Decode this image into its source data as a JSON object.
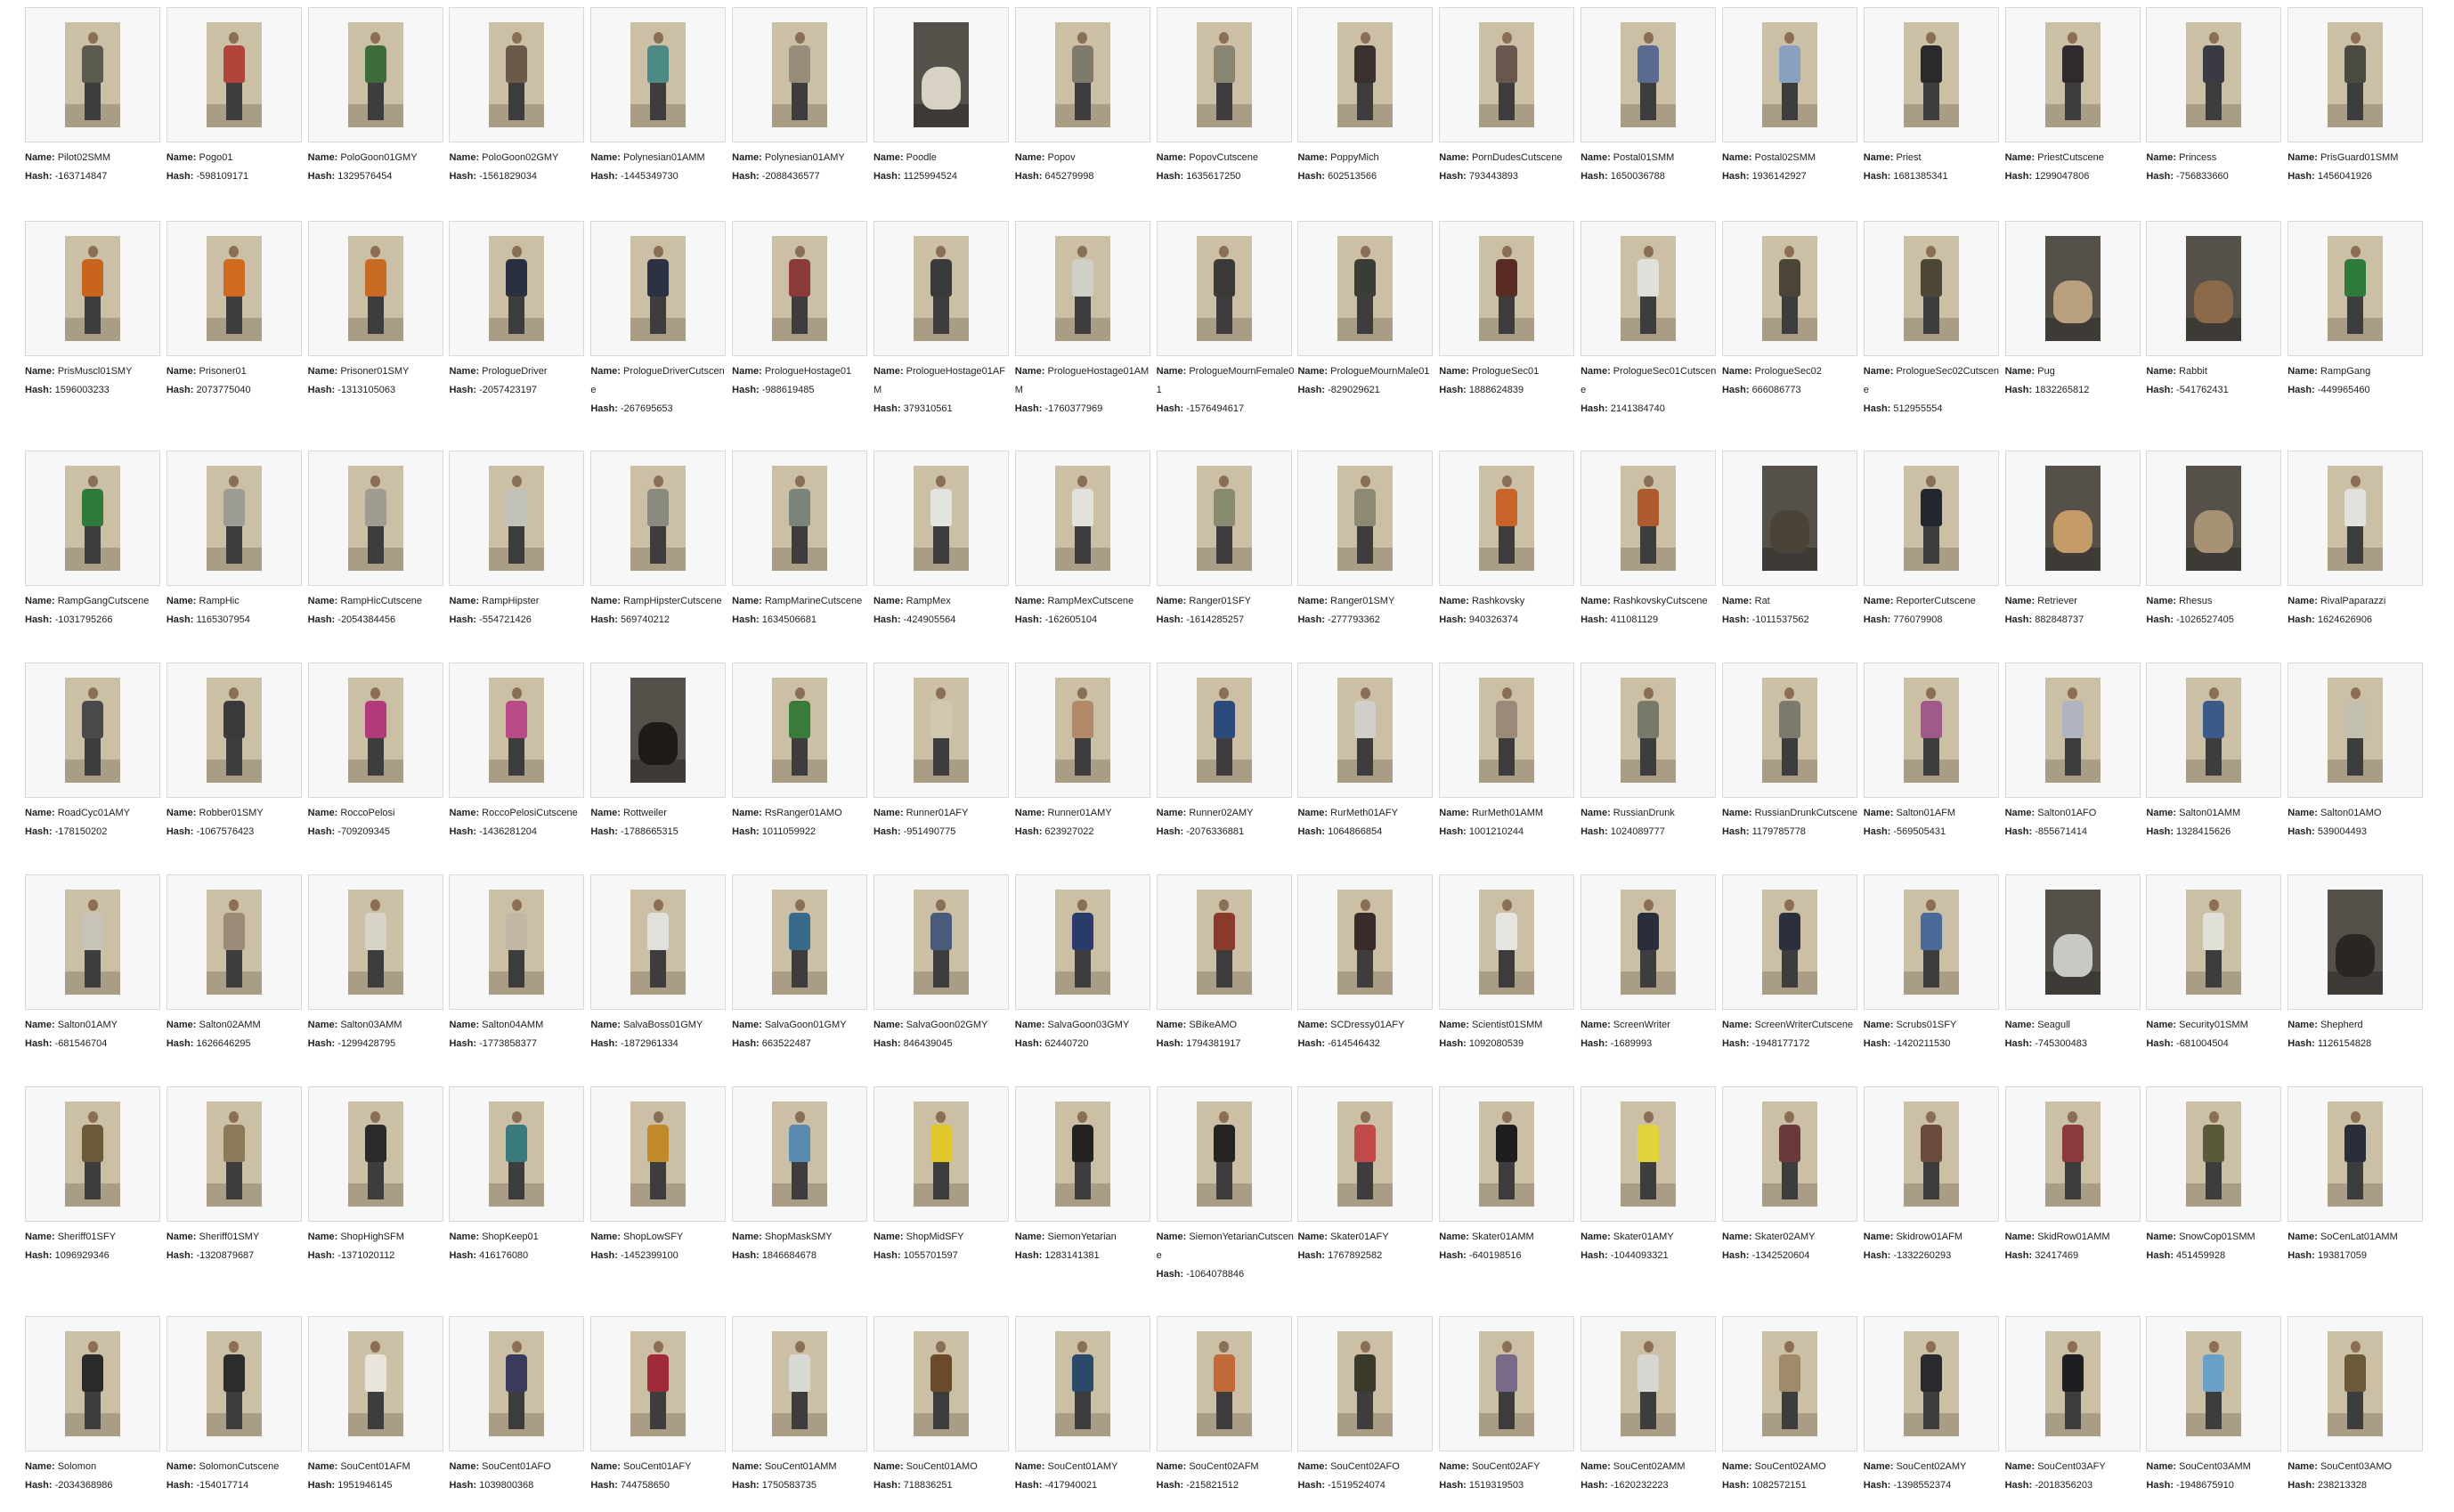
{
  "rows": [
    [
      {
        "name": "Pilot02SMM",
        "hash": "-163714847",
        "color": "#5a5a4e",
        "kind": "person"
      },
      {
        "name": "Pogo01",
        "hash": "-598109171",
        "color": "#b0443a",
        "kind": "person"
      },
      {
        "name": "PoloGoon01GMY",
        "hash": "1329576454",
        "color": "#3e6b3a",
        "kind": "person"
      },
      {
        "name": "PoloGoon02GMY",
        "hash": "-1561829034",
        "color": "#6a5a4a",
        "kind": "person"
      },
      {
        "name": "Polynesian01AMM",
        "hash": "-1445349730",
        "color": "#4f8b86",
        "kind": "person"
      },
      {
        "name": "Polynesian01AMY",
        "hash": "-2088436577",
        "color": "#9a8c7a",
        "kind": "person"
      },
      {
        "name": "Poodle",
        "hash": "1125994524",
        "color": "#d8d2c4",
        "kind": "animal"
      },
      {
        "name": "Popov",
        "hash": "645279998",
        "color": "#7f7a6a",
        "kind": "person"
      },
      {
        "name": "PopovCutscene",
        "hash": "1635617250",
        "color": "#8a8572",
        "kind": "person"
      },
      {
        "name": "PoppyMich",
        "hash": "602513566",
        "color": "#3a3030",
        "kind": "person"
      },
      {
        "name": "PornDudesCutscene",
        "hash": "793443893",
        "color": "#6a5850",
        "kind": "person"
      },
      {
        "name": "Postal01SMM",
        "hash": "1650036788",
        "color": "#5a6a90",
        "kind": "person"
      },
      {
        "name": "Postal02SMM",
        "hash": "1936142927",
        "color": "#8aa0c0",
        "kind": "person"
      },
      {
        "name": "Priest",
        "hash": "1681385341",
        "color": "#2a2a2a",
        "kind": "person"
      },
      {
        "name": "PriestCutscene",
        "hash": "1299047806",
        "color": "#2e2a2e",
        "kind": "person"
      },
      {
        "name": "Princess",
        "hash": "-756833660",
        "color": "#3a3a44",
        "kind": "person"
      },
      {
        "name": "PrisGuard01SMM",
        "hash": "1456041926",
        "color": "#4a4a40",
        "kind": "person"
      }
    ],
    [
      {
        "name": "PrisMuscl01SMY",
        "hash": "1596003233",
        "color": "#c8641e",
        "kind": "person"
      },
      {
        "name": "Prisoner01",
        "hash": "2073775040",
        "color": "#d06a20",
        "kind": "person"
      },
      {
        "name": "Prisoner01SMY",
        "hash": "-1313105063",
        "color": "#c96a24",
        "kind": "person"
      },
      {
        "name": "PrologueDriver",
        "hash": "-2057423197",
        "color": "#2a3040",
        "kind": "person"
      },
      {
        "name": "PrologueDriverCutscene",
        "hash": "-267695653",
        "color": "#2c3242",
        "kind": "person"
      },
      {
        "name": "PrologueHostage01",
        "hash": "-988619485",
        "color": "#8a3a3a",
        "kind": "person"
      },
      {
        "name": "PrologueHostage01AFM",
        "hash": "379310561",
        "color": "#3a3a3a",
        "kind": "person"
      },
      {
        "name": "PrologueHostage01AMM",
        "hash": "-1760377969",
        "color": "#cfcfc6",
        "kind": "person"
      },
      {
        "name": "PrologueMournFemale01",
        "hash": "-1576494617",
        "color": "#3a3a36",
        "kind": "person"
      },
      {
        "name": "PrologueMournMale01",
        "hash": "-829029621",
        "color": "#3a3c38",
        "kind": "person"
      },
      {
        "name": "PrologueSec01",
        "hash": "1888624839",
        "color": "#5a2a24",
        "kind": "person"
      },
      {
        "name": "PrologueSec01Cutscene",
        "hash": "2141384740",
        "color": "#e0e0da",
        "kind": "person"
      },
      {
        "name": "PrologueSec02",
        "hash": "666086773",
        "color": "#4a4536",
        "kind": "person"
      },
      {
        "name": "PrologueSec02Cutscene",
        "hash": "512955554",
        "color": "#4c4636",
        "kind": "person"
      },
      {
        "name": "Pug",
        "hash": "1832265812",
        "color": "#b8a07e",
        "kind": "animal"
      },
      {
        "name": "Rabbit",
        "hash": "-541762431",
        "color": "#8a6a48",
        "kind": "animal"
      },
      {
        "name": "RampGang",
        "hash": "-449965460",
        "color": "#2f7a3a",
        "kind": "person"
      }
    ],
    [
      {
        "name": "RampGangCutscene",
        "hash": "-1031795266",
        "color": "#2f7a3a",
        "kind": "person"
      },
      {
        "name": "RampHic",
        "hash": "1165307954",
        "color": "#9c9c94",
        "kind": "person"
      },
      {
        "name": "RampHicCutscene",
        "hash": "-2054384456",
        "color": "#a09c92",
        "kind": "person"
      },
      {
        "name": "RampHipster",
        "hash": "-554721426",
        "color": "#c2c2ba",
        "kind": "person"
      },
      {
        "name": "RampHipsterCutscene",
        "hash": "569740212",
        "color": "#8a8a7e",
        "kind": "person"
      },
      {
        "name": "RampMarineCutscene",
        "hash": "1634506681",
        "color": "#7a8478",
        "kind": "person"
      },
      {
        "name": "RampMex",
        "hash": "-424905564",
        "color": "#e4e4de",
        "kind": "person"
      },
      {
        "name": "RampMexCutscene",
        "hash": "-162605104",
        "color": "#e2e2dc",
        "kind": "person"
      },
      {
        "name": "Ranger01SFY",
        "hash": "-1614285257",
        "color": "#8a8a70",
        "kind": "person"
      },
      {
        "name": "Ranger01SMY",
        "hash": "-277793362",
        "color": "#8c8a72",
        "kind": "person"
      },
      {
        "name": "Rashkovsky",
        "hash": "940326374",
        "color": "#c8642a",
        "kind": "person"
      },
      {
        "name": "RashkovskyCutscene",
        "hash": "411081129",
        "color": "#b05a30",
        "kind": "person"
      },
      {
        "name": "Rat",
        "hash": "-1011537562",
        "color": "#4a4438",
        "kind": "animal"
      },
      {
        "name": "ReporterCutscene",
        "hash": "776079908",
        "color": "#22262e",
        "kind": "person"
      },
      {
        "name": "Retriever",
        "hash": "882848737",
        "color": "#c49a66",
        "kind": "animal"
      },
      {
        "name": "Rhesus",
        "hash": "-1026527405",
        "color": "#a89276",
        "kind": "animal"
      },
      {
        "name": "RivalPaparazzi",
        "hash": "1624626906",
        "color": "#e2e2dc",
        "kind": "person"
      }
    ],
    [
      {
        "name": "RoadCyc01AMY",
        "hash": "-178150202",
        "color": "#4a4a4a",
        "kind": "person"
      },
      {
        "name": "Robber01SMY",
        "hash": "-1067576423",
        "color": "#3a3a3a",
        "kind": "person"
      },
      {
        "name": "RoccoPelosi",
        "hash": "-709209345",
        "color": "#b03a7a",
        "kind": "person"
      },
      {
        "name": "RoccoPelosiCutscene",
        "hash": "-1436281204",
        "color": "#b84a86",
        "kind": "person"
      },
      {
        "name": "Rottweiler",
        "hash": "-1788665315",
        "color": "#1e1a18",
        "kind": "animal"
      },
      {
        "name": "RsRanger01AMO",
        "hash": "1011059922",
        "color": "#3a7a3a",
        "kind": "person"
      },
      {
        "name": "Runner01AFY",
        "hash": "-951490775",
        "color": "#d0c8b0",
        "kind": "person"
      },
      {
        "name": "Runner01AMY",
        "hash": "623927022",
        "color": "#b08a6a",
        "kind": "person"
      },
      {
        "name": "Runner02AMY",
        "hash": "-2076336881",
        "color": "#2a4a7a",
        "kind": "person"
      },
      {
        "name": "RurMeth01AFY",
        "hash": "1064866854",
        "color": "#d0cfc8",
        "kind": "person"
      },
      {
        "name": "RurMeth01AMM",
        "hash": "1001210244",
        "color": "#9a8a7a",
        "kind": "person"
      },
      {
        "name": "RussianDrunk",
        "hash": "1024089777",
        "color": "#7a7a6a",
        "kind": "person"
      },
      {
        "name": "RussianDrunkCutscene",
        "hash": "1179785778",
        "color": "#7c7a6c",
        "kind": "person"
      },
      {
        "name": "Salton01AFM",
        "hash": "-569505431",
        "color": "#a05a8a",
        "kind": "person"
      },
      {
        "name": "Salton01AFO",
        "hash": "-855671414",
        "color": "#b0b4c0",
        "kind": "person"
      },
      {
        "name": "Salton01AMM",
        "hash": "1328415626",
        "color": "#3a5a8a",
        "kind": "person"
      },
      {
        "name": "Salton01AMO",
        "hash": "539004493",
        "color": "#c4c0b0",
        "kind": "person"
      }
    ],
    [
      {
        "name": "Salton01AMY",
        "hash": "-681546704",
        "color": "#c8c4b8",
        "kind": "person"
      },
      {
        "name": "Salton02AMM",
        "hash": "1626646295",
        "color": "#9a8a76",
        "kind": "person"
      },
      {
        "name": "Salton03AMM",
        "hash": "-1299428795",
        "color": "#d8d4c8",
        "kind": "person"
      },
      {
        "name": "Salton04AMM",
        "hash": "-1773858377",
        "color": "#c0b8a4",
        "kind": "person"
      },
      {
        "name": "SalvaBoss01GMY",
        "hash": "-1872961334",
        "color": "#e0e0dc",
        "kind": "person"
      },
      {
        "name": "SalvaGoon01GMY",
        "hash": "663522487",
        "color": "#3a6a8a",
        "kind": "person"
      },
      {
        "name": "SalvaGoon02GMY",
        "hash": "846439045",
        "color": "#4a5a7a",
        "kind": "person"
      },
      {
        "name": "SalvaGoon03GMY",
        "hash": "62440720",
        "color": "#2a3a6a",
        "kind": "person"
      },
      {
        "name": "SBikeAMO",
        "hash": "1794381917",
        "color": "#8a3a2a",
        "kind": "person"
      },
      {
        "name": "SCDressy01AFY",
        "hash": "-614546432",
        "color": "#3a2a2a",
        "kind": "person"
      },
      {
        "name": "Scientist01SMM",
        "hash": "1092080539",
        "color": "#e4e4e0",
        "kind": "person"
      },
      {
        "name": "ScreenWriter",
        "hash": "-1689993",
        "color": "#2a2e3a",
        "kind": "person"
      },
      {
        "name": "ScreenWriterCutscene",
        "hash": "-1948177172",
        "color": "#2c303c",
        "kind": "person"
      },
      {
        "name": "Scrubs01SFY",
        "hash": "-1420211530",
        "color": "#4a6a9a",
        "kind": "person"
      },
      {
        "name": "Seagull",
        "hash": "-745300483",
        "color": "#c8c8c4",
        "kind": "animal"
      },
      {
        "name": "Security01SMM",
        "hash": "-681004504",
        "color": "#e0e0d8",
        "kind": "person"
      },
      {
        "name": "Shepherd",
        "hash": "1126154828",
        "color": "#2a2622",
        "kind": "animal"
      }
    ],
    [
      {
        "name": "Sheriff01SFY",
        "hash": "1096929346",
        "color": "#6a5a3a",
        "kind": "person"
      },
      {
        "name": "Sheriff01SMY",
        "hash": "-1320879687",
        "color": "#8a7a5a",
        "kind": "person"
      },
      {
        "name": "ShopHighSFM",
        "hash": "-1371020112",
        "color": "#2a2a2a",
        "kind": "person"
      },
      {
        "name": "ShopKeep01",
        "hash": "416176080",
        "color": "#3a7a7a",
        "kind": "person"
      },
      {
        "name": "ShopLowSFY",
        "hash": "-1452399100",
        "color": "#c08a2a",
        "kind": "person"
      },
      {
        "name": "ShopMaskSMY",
        "hash": "1846684678",
        "color": "#5a8ab0",
        "kind": "person"
      },
      {
        "name": "ShopMidSFY",
        "hash": "1055701597",
        "color": "#e0c82a",
        "kind": "person"
      },
      {
        "name": "SiemonYetarian",
        "hash": "1283141381",
        "color": "#222222",
        "kind": "person"
      },
      {
        "name": "SiemonYetarianCutscene",
        "hash": "-1064078846",
        "color": "#242424",
        "kind": "person"
      },
      {
        "name": "Skater01AFY",
        "hash": "1767892582",
        "color": "#c04a4a",
        "kind": "person"
      },
      {
        "name": "Skater01AMM",
        "hash": "-640198516",
        "color": "#1e1e1e",
        "kind": "person"
      },
      {
        "name": "Skater01AMY",
        "hash": "-1044093321",
        "color": "#e0d43a",
        "kind": "person"
      },
      {
        "name": "Skater02AMY",
        "hash": "-1342520604",
        "color": "#6a3a3a",
        "kind": "person"
      },
      {
        "name": "Skidrow01AFM",
        "hash": "-1332260293",
        "color": "#6a4a3a",
        "kind": "person"
      },
      {
        "name": "SkidRow01AMM",
        "hash": "32417469",
        "color": "#8a3a3a",
        "kind": "person"
      },
      {
        "name": "SnowCop01SMM",
        "hash": "451459928",
        "color": "#5a5a3a",
        "kind": "person"
      },
      {
        "name": "SoCenLat01AMM",
        "hash": "193817059",
        "color": "#2a2e3a",
        "kind": "person"
      }
    ],
    [
      {
        "name": "Solomon",
        "hash": "-2034368986",
        "color": "#2a2a28",
        "kind": "person"
      },
      {
        "name": "SolomonCutscene",
        "hash": "-154017714",
        "color": "#2c2c2a",
        "kind": "person"
      },
      {
        "name": "SouCent01AFM",
        "hash": "1951946145",
        "color": "#e8e4dc",
        "kind": "person"
      },
      {
        "name": "SouCent01AFO",
        "hash": "1039800368",
        "color": "#3a3a5a",
        "kind": "person"
      },
      {
        "name": "SouCent01AFY",
        "hash": "744758650",
        "color": "#a02a3a",
        "kind": "person"
      },
      {
        "name": "SouCent01AMM",
        "hash": "1750583735",
        "color": "#d8d8d4",
        "kind": "person"
      },
      {
        "name": "SouCent01AMO",
        "hash": "718836251",
        "color": "#6a4a2a",
        "kind": "person"
      },
      {
        "name": "SouCent01AMY",
        "hash": "-417940021",
        "color": "#2a4a6a",
        "kind": "person"
      },
      {
        "name": "SouCent02AFM",
        "hash": "-215821512",
        "color": "#c06a3a",
        "kind": "person"
      },
      {
        "name": "SouCent02AFO",
        "hash": "-1519524074",
        "color": "#3a3a2a",
        "kind": "person"
      },
      {
        "name": "SouCent02AFY",
        "hash": "1519319503",
        "color": "#7a6a8a",
        "kind": "person"
      },
      {
        "name": "SouCent02AMM",
        "hash": "-1620232223",
        "color": "#d8d6d0",
        "kind": "person"
      },
      {
        "name": "SouCent02AMO",
        "hash": "1082572151",
        "color": "#a08a6a",
        "kind": "person"
      },
      {
        "name": "SouCent02AMY",
        "hash": "-1398552374",
        "color": "#2a2a2e",
        "kind": "person"
      },
      {
        "name": "SouCent03AFY",
        "hash": "-2018356203",
        "color": "#1e1e22",
        "kind": "person"
      },
      {
        "name": "SouCent03AMM",
        "hash": "-1948675910",
        "color": "#6aa0c8",
        "kind": "person"
      },
      {
        "name": "SouCent03AMO",
        "hash": "238213328",
        "color": "#6a5a3a",
        "kind": "person"
      }
    ]
  ],
  "labels": {
    "name": "Name:",
    "hash": "Hash:"
  }
}
